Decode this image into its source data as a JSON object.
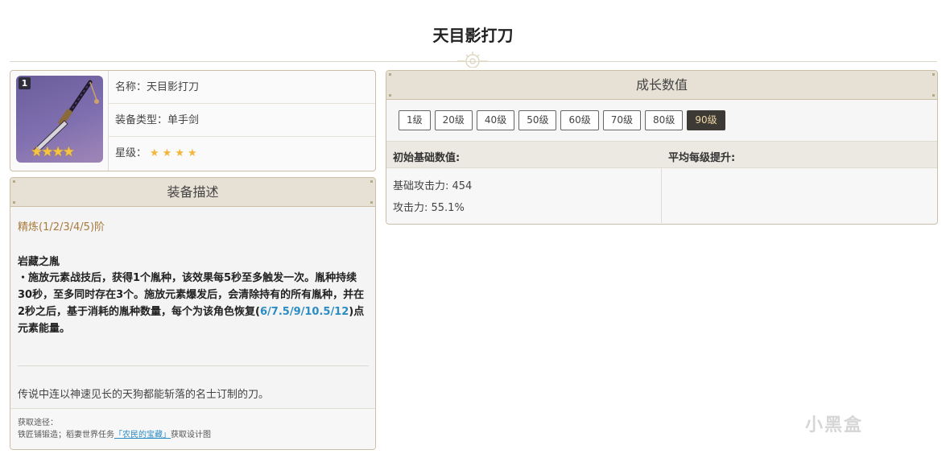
{
  "page": {
    "title": "天目影打刀"
  },
  "info": {
    "level_badge": "1",
    "name_label": "名称：天目影打刀",
    "type_label": "装备类型：单手剑",
    "star_label": "星级：",
    "stars": "★★★★",
    "portrait_stars": "★★★★"
  },
  "description": {
    "header": "装备描述",
    "refine": "精炼(1/2/3/4/5)阶",
    "skill_name": "岩藏之胤",
    "skill_text_1": "・施放元素战技后，获得1个胤种，该效果每5秒至多触发一次。胤种持续30秒，至多同时存在3个。施放元素爆发后，会清除持有的所有胤种，并在2秒之后，基于消耗的胤种数量，每个为该角色恢复(",
    "skill_values": "6/7.5/9/10.5/12",
    "skill_text_2": ")点元素能量。",
    "lore": "传说中连以神速见长的天狗都能斩落的名士订制的刀。",
    "source_label": "获取途径：",
    "source_text": "铁匠铺锻造；稻妻世界任务",
    "source_quest": "「农民的宝藏」",
    "source_suffix": "获取设计图"
  },
  "growth": {
    "header": "成长数值",
    "levels": [
      "1级",
      "20级",
      "40级",
      "50级",
      "60级",
      "70级",
      "80级",
      "90级"
    ],
    "active_level": "90级",
    "col_base": "初始基础数值:",
    "col_avg": "平均每级提升:",
    "stat_atk": "基础攻击力: 454",
    "stat_sub": "攻击力: 55.1%"
  },
  "watermark": "小黑盒"
}
